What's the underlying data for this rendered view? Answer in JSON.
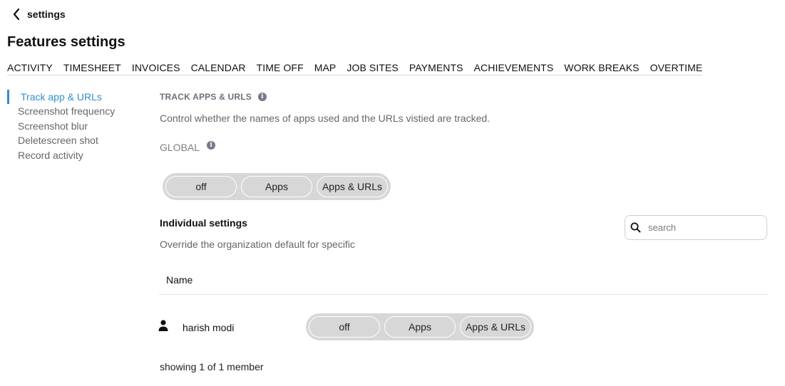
{
  "header": {
    "back_label": "settings",
    "back_icon": "chevron-left-icon",
    "page_title": "Features settings"
  },
  "tabs": [
    {
      "label": "ACTIVITY"
    },
    {
      "label": "TIMESHEET"
    },
    {
      "label": "INVOICES"
    },
    {
      "label": "CALENDAR"
    },
    {
      "label": "TIME OFF"
    },
    {
      "label": "MAP"
    },
    {
      "label": "JOB SITES"
    },
    {
      "label": "PAYMENTS"
    },
    {
      "label": "ACHIEVEMENTS"
    },
    {
      "label": "WORK BREAKS"
    },
    {
      "label": "OVERTIME"
    }
  ],
  "sidebar": {
    "items": [
      {
        "label": "Track app & URLs",
        "active": true
      },
      {
        "label": "Screenshot frequency",
        "active": false
      },
      {
        "label": "Screenshot blur",
        "active": false
      },
      {
        "label": "Deletescreen shot",
        "active": false
      },
      {
        "label": "Record activity",
        "active": false
      }
    ]
  },
  "section": {
    "title": "TRACK APPS & URLS",
    "description": "Control whether the names of apps used and the URLs vistied are tracked.",
    "global_label": "GLOBAL",
    "info_icon": "info-icon"
  },
  "global_options": [
    "off",
    "Apps",
    "Apps & URLs"
  ],
  "individual": {
    "title": "Individual settings",
    "description": "Override the organization default for specific",
    "search_placeholder": "search",
    "search_icon": "search-icon",
    "name_column": "Name",
    "members": [
      {
        "name": "harish modi",
        "icon": "person-icon",
        "options": [
          "off",
          "Apps",
          "Apps & URLs"
        ]
      }
    ],
    "footer": "showing 1 of 1 member"
  },
  "colors": {
    "accent": "#2e8fd1",
    "muted_text": "#666666",
    "segment_bg": "#d7d7d7",
    "info_icon_bg": "#75798a"
  }
}
